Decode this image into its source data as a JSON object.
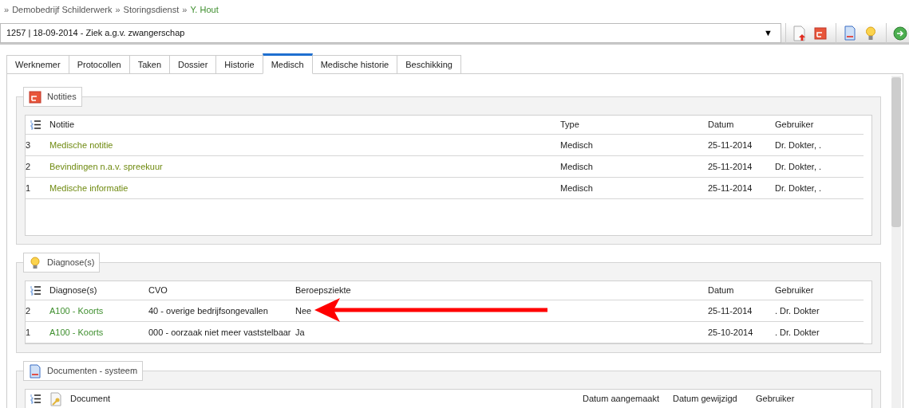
{
  "breadcrumb": {
    "separator": "»",
    "items": [
      {
        "label": "Demobedrijf Schilderwerk",
        "current": false
      },
      {
        "label": "Storingsdienst",
        "current": false
      },
      {
        "label": "Y. Hout",
        "current": true
      }
    ]
  },
  "case_select": {
    "value": "1257 | 18-09-2014 - Ziek a.g.v. zwangerschap",
    "arrow": "▼"
  },
  "tabs": [
    {
      "label": "Werknemer",
      "selected": false
    },
    {
      "label": "Protocollen",
      "selected": false
    },
    {
      "label": "Taken",
      "selected": false
    },
    {
      "label": "Dossier",
      "selected": false
    },
    {
      "label": "Historie",
      "selected": false
    },
    {
      "label": "Medisch",
      "selected": true
    },
    {
      "label": "Medische historie",
      "selected": false
    },
    {
      "label": "Beschikking",
      "selected": false
    }
  ],
  "sections": [
    {
      "kind": "notes",
      "title": "Notities",
      "columns": [
        "",
        "Notitie",
        "Type",
        "Datum",
        "Gebruiker"
      ],
      "rows": [
        [
          "3",
          "Medische notitie",
          "Medisch",
          "25-11-2014",
          "Dr. Dokter, ."
        ],
        [
          "2",
          "Bevindingen n.a.v. spreekuur",
          "Medisch",
          "25-11-2014",
          "Dr. Dokter, ."
        ],
        [
          "1",
          "Medische informatie",
          "Medisch",
          "25-11-2014",
          "Dr. Dokter, ."
        ]
      ]
    },
    {
      "kind": "diagnoses",
      "title": "Diagnose(s)",
      "columns": [
        "",
        "Diagnose(s)",
        "CVO",
        "Beroepsziekte",
        "Datum",
        "Gebruiker"
      ],
      "rows": [
        [
          "2",
          "A100 - Koorts",
          "40 - overige bedrijfsongevallen",
          "Nee",
          "25-11-2014",
          ". Dr. Dokter"
        ],
        [
          "1",
          "A100 - Koorts",
          "000 - oorzaak niet meer vaststelbaar",
          "Ja",
          "25-10-2014",
          ". Dr. Dokter"
        ]
      ]
    },
    {
      "kind": "documents",
      "title": "Documenten - systeem",
      "columns": [
        "",
        "Document",
        "Datum aangemaakt",
        "Datum gewijzigd",
        "Gebruiker"
      ]
    }
  ]
}
